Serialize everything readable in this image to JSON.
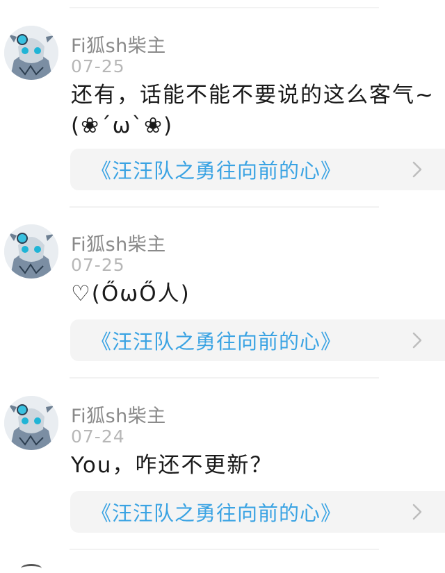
{
  "comments": [
    {
      "username": "Fi狐sh柴主",
      "date": "07-25",
      "text": "还有，话能不能不要说的这么客气~(❀´ω`❀)",
      "book": "《汪汪队之勇往向前的心》"
    },
    {
      "username": "Fi狐sh柴主",
      "date": "07-25",
      "text": "♡(ŐωŐ人)",
      "book": "《汪汪队之勇往向前的心》"
    },
    {
      "username": "Fi狐sh柴主",
      "date": "07-24",
      "text": "You，咋还不更新？",
      "book": "《汪汪队之勇往向前的心》"
    }
  ],
  "icons": {
    "avatar": "anime-avatar-icon",
    "chevron": "chevron-right-icon"
  },
  "colors": {
    "book_link": "#3aa3e3",
    "username": "#8a8a8a",
    "date": "#b7b7b7",
    "card_bg": "#f4f4f4"
  }
}
